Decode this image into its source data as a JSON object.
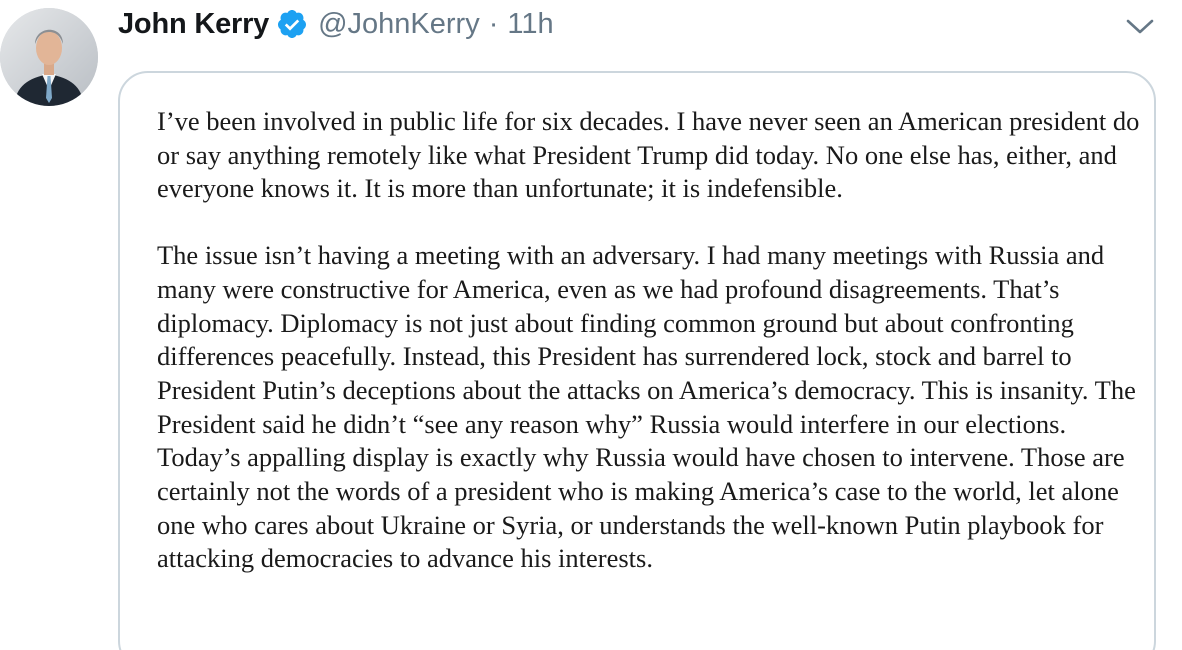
{
  "tweet": {
    "author": {
      "display_name": "John Kerry",
      "verified": true,
      "handle": "@JohnKerry",
      "avatar_alt": "John Kerry profile photo"
    },
    "separator": "·",
    "timestamp": "11h",
    "icons": {
      "verified": "verified-badge-icon",
      "menu": "chevron-down-icon"
    },
    "colors": {
      "verified_blue": "#1da1f2",
      "secondary_text": "#657786",
      "card_border": "#ccd6dd"
    },
    "image_text": {
      "paragraphs": [
        "I’ve been involved in public life for six decades. I have never seen an American president do or say anything remotely like what President Trump did today. No one else has, either, and everyone knows it. It is more than unfortunate; it is indefensible.",
        "The issue isn’t having a meeting with an adversary. I had many meetings with Russia and many were constructive for America, even as we had profound disagreements. That’s diplomacy. Diplomacy is not just about finding common ground but about confronting differences peacefully. Instead, this President has surrendered lock, stock and barrel to President Putin’s deceptions about the attacks on America’s democracy. This is insanity. The President said he didn’t “see any reason why” Russia would interfere in our elections. Today’s appalling display is exactly why Russia would have chosen to intervene. Those are certainly not the words of a president who is making America’s case to the world, let alone one who cares about Ukraine or Syria, or understands the well-known Putin playbook for attacking democracies to advance his interests."
      ]
    }
  }
}
